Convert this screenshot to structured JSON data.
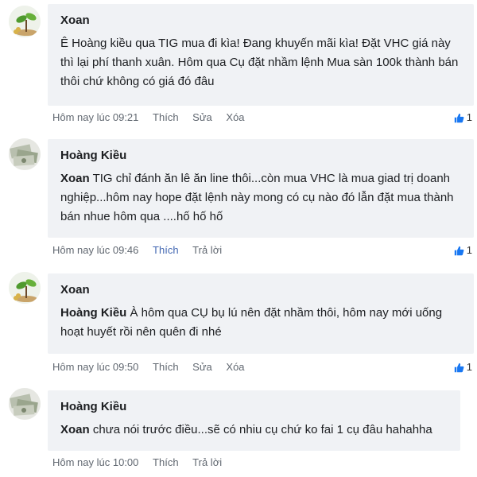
{
  "comments": [
    {
      "author": "Xoan",
      "avatar_icon": "sprout-icon",
      "mention": "",
      "text": "Ê Hoàng kiều qua TIG mua đi kìa! Đang khuyến mãi kìa! Đặt VHC giá này thì lại phí thanh xuân. Hôm qua Cụ đặt nhầm lệnh Mua sàn 100k thành bán thôi chứ không có giá đó đâu",
      "time": "Hôm nay lúc 09:21",
      "actions": [
        "Thích",
        "Sửa",
        "Xóa"
      ],
      "likes": "1"
    },
    {
      "author": "Hoàng Kiều",
      "avatar_icon": "money-icon",
      "mention": "Xoan",
      "text": " TIG chỉ đánh ăn lê ăn line thôi...còn mua VHC là mua giad trị doanh nghiệp...hôm nay hope đặt lệnh này mong có cụ nào đó lẫn đặt mua thành bán nhue hôm qua ....hố hố hố",
      "time": "Hôm nay lúc 09:46",
      "actions": [
        "Thích",
        "Trả lời"
      ],
      "likes": "1"
    },
    {
      "author": "Xoan",
      "avatar_icon": "sprout-icon",
      "mention": "Hoàng Kiều",
      "text": "  À hôm qua CỤ bụ lú nên đặt nhầm thôi, hôm nay mới uống hoạt huyết rồi nên quên đi nhé",
      "time": "Hôm nay lúc 09:50",
      "actions": [
        "Thích",
        "Sửa",
        "Xóa"
      ],
      "likes": "1"
    },
    {
      "author": "Hoàng Kiều",
      "avatar_icon": "money-icon",
      "mention": "Xoan",
      "text": " chưa nói trước điều...sẽ có nhiu cụ chứ ko fai 1 cụ đâu hahahha",
      "time": "Hôm nay lúc 10:00",
      "actions": [
        "Thích",
        "Trả lời"
      ],
      "likes": ""
    }
  ],
  "colors": {
    "bubble_bg": "#f0f2f5",
    "meta_text": "#606770",
    "link_blue": "#4267b2",
    "like_blue": "#1877f2"
  }
}
